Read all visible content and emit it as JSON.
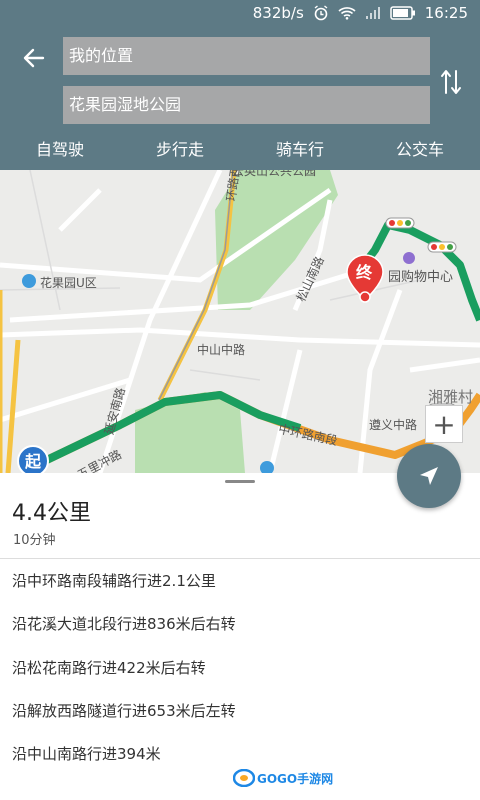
{
  "status_bar": {
    "speed": "832b/s",
    "time": "16:25"
  },
  "header": {
    "from_value": "我的位置",
    "to_value": "花果园湿地公园",
    "tabs": [
      {
        "label": "自驾驶"
      },
      {
        "label": "步行走"
      },
      {
        "label": "骑车行"
      },
      {
        "label": "公交车"
      }
    ]
  },
  "map": {
    "labels": {
      "ring_road_west": "环路西段",
      "songshan_road": "松山南路",
      "huaguoyuan_u": "花果园U区",
      "mall": "园购物中心",
      "zhongshan_middle": "中山中路",
      "yanan_road": "延安南路",
      "ring_road_south": "中环路南段",
      "zunyi_road": "遵义中路",
      "xiangya": "湘雅村",
      "wuli_road": "五里冲路",
      "top_label": "云英山公共公园"
    },
    "start_label": "起",
    "end_label": "终",
    "colors": {
      "route_green": "#1a9e5f",
      "route_orange": "#f0a030",
      "park": "#b9dfb1",
      "road": "#ffffff",
      "accent": "#5d7a85"
    }
  },
  "route": {
    "distance": "4.4公里",
    "duration": "10分钟",
    "steps": [
      "沿中环路南段辅路行进2.1公里",
      "沿花溪大道北段行进836米后右转",
      "沿松花南路行进422米后右转",
      "沿解放西路隧道行进653米后左转",
      "沿中山南路行进394米"
    ]
  },
  "watermark": "GOGO手游网"
}
